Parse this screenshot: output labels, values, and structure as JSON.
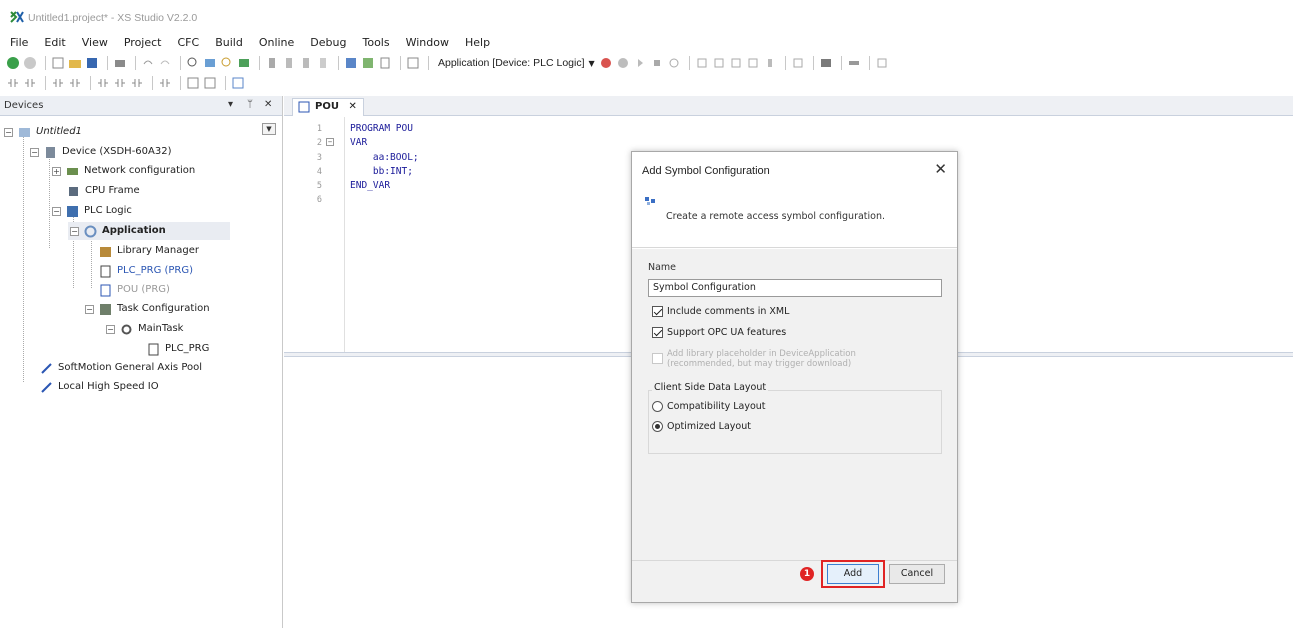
{
  "window": {
    "title": "Untitled1.project* - XS Studio V2.2.0"
  },
  "menu": [
    "File",
    "Edit",
    "View",
    "Project",
    "CFC",
    "Build",
    "Online",
    "Debug",
    "Tools",
    "Window",
    "Help"
  ],
  "toolbar": {
    "application_combo": "Application [Device: PLC Logic]"
  },
  "devices_panel": {
    "title": "Devices",
    "pin_glyph": "▾ ⊣",
    "close_glyph": "✕",
    "tree": {
      "untitled": "Untitled1",
      "device": "Device (XSDH-60A32)",
      "network": "Network configuration",
      "cpu_frame": "CPU Frame",
      "plc_logic": "PLC Logic",
      "application": "Application",
      "library_manager": "Library Manager",
      "plc_prg": "PLC_PRG (PRG)",
      "pou": "POU (PRG)",
      "task_configuration": "Task Configuration",
      "main_task": "MainTask",
      "main_task_prg": "PLC_PRG",
      "softmotion": "SoftMotion General Axis Pool",
      "local_io": "Local High Speed IO"
    }
  },
  "editor": {
    "tab_label": "POU",
    "tab_close": "✕",
    "lines": [
      {
        "num": "1",
        "text": "PROGRAM POU"
      },
      {
        "num": "2",
        "text": "VAR"
      },
      {
        "num": "3",
        "text": "    aa:BOOL;"
      },
      {
        "num": "4",
        "text": "    bb:INT;"
      },
      {
        "num": "5",
        "text": "END_VAR"
      },
      {
        "num": "6",
        "text": ""
      }
    ]
  },
  "dialog": {
    "title": "Add Symbol Configuration",
    "close": "✕",
    "description": "Create a remote access symbol configuration.",
    "name_label": "Name",
    "name_value": "Symbol Configuration",
    "checkbox_xml": "Include comments in XML",
    "checkbox_opcua": "Support OPC UA features",
    "checkbox_library_line1": "Add library placeholder in DeviceApplication",
    "checkbox_library_line2": "(recommended, but may trigger download)",
    "group_label": "Client Side Data Layout",
    "radio_compat": "Compatibility Layout",
    "radio_optimized": "Optimized Layout",
    "add_label": "Add",
    "cancel_label": "Cancel",
    "step_number": "1"
  },
  "colors": {
    "accent": "#3c7fd1",
    "highlight": "#e02424",
    "panel_header": "#eceff4"
  }
}
